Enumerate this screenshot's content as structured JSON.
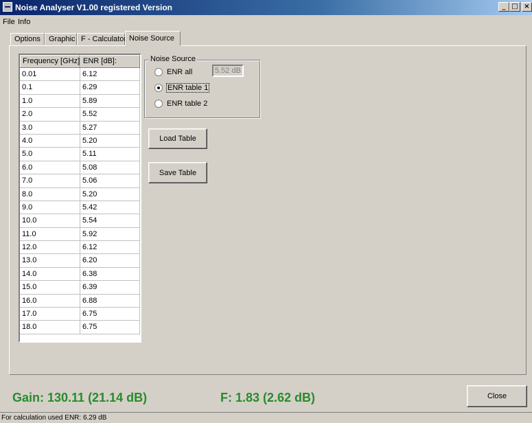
{
  "window": {
    "title": "Noise Analyser V1.00 registered Version",
    "minimize": "_",
    "maximize": "□",
    "close": "×"
  },
  "menu": {
    "file": "File",
    "info": "Info"
  },
  "tabs": [
    {
      "label": "Options"
    },
    {
      "label": "Graphic"
    },
    {
      "label": "F - Calculator"
    },
    {
      "label": "Noise Source"
    }
  ],
  "table": {
    "headers": [
      "Frequency [GHz]:",
      "ENR [dB]:"
    ],
    "rows": [
      [
        "0.01",
        "6.12"
      ],
      [
        "0.1",
        "6.29"
      ],
      [
        "1.0",
        "5.89"
      ],
      [
        "2.0",
        "5.52"
      ],
      [
        "3.0",
        "5.27"
      ],
      [
        "4.0",
        "5.20"
      ],
      [
        "5.0",
        "5.11"
      ],
      [
        "6.0",
        "5.08"
      ],
      [
        "7.0",
        "5.06"
      ],
      [
        "8.0",
        "5.20"
      ],
      [
        "9.0",
        "5.42"
      ],
      [
        "10.0",
        "5.54"
      ],
      [
        "11.0",
        "5.92"
      ],
      [
        "12.0",
        "6.12"
      ],
      [
        "13.0",
        "6.20"
      ],
      [
        "14.0",
        "6.38"
      ],
      [
        "15.0",
        "6.39"
      ],
      [
        "16.0",
        "6.88"
      ],
      [
        "17.0",
        "6.75"
      ],
      [
        "18.0",
        "6.75"
      ]
    ]
  },
  "noise_source": {
    "legend": "Noise Source",
    "enr_all_label": "ENR all",
    "enr_all_value": "5.52 dB",
    "enr_table1_label": "ENR table 1",
    "enr_table2_label": "ENR table 2",
    "selected": "ENR table 1"
  },
  "buttons": {
    "load_table": "Load Table",
    "save_table": "Save Table",
    "close": "Close"
  },
  "results": {
    "gain": "Gain: 130.11  (21.14 dB)",
    "f": "F: 1.83  (2.62 dB)",
    "color": "#2a8a2a"
  },
  "status": {
    "text": "For calculation used ENR: 6.29 dB"
  }
}
